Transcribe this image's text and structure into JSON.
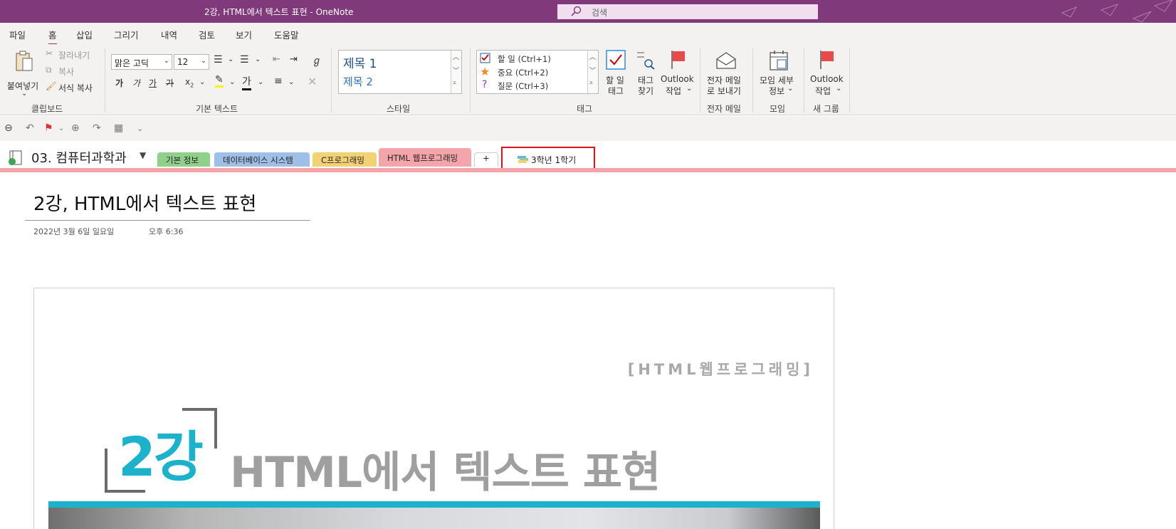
{
  "window": {
    "title": "2강, HTML에서 텍스트 표현  -  OneNote",
    "search_placeholder": "검색"
  },
  "menu": [
    "파일",
    "홈",
    "삽입",
    "그리기",
    "내역",
    "검토",
    "보기",
    "도움말"
  ],
  "ribbon": {
    "clipboard": {
      "paste": "붙여넣기",
      "cut": "잘라내기",
      "copy": "복사",
      "format_painter": "서식 복사",
      "label": "클립보드"
    },
    "basic_text": {
      "font": "맑은 고딕",
      "size": "12",
      "bold": "가",
      "italic": "가",
      "underline": "가",
      "strike": "가",
      "subscript": "x",
      "label": "기본 텍스트"
    },
    "styles": {
      "items": [
        "제목 1",
        "제목 2"
      ],
      "label": "스타일"
    },
    "tags": {
      "items": [
        "할 일 (Ctrl+1)",
        "중요 (Ctrl+2)",
        "질문 (Ctrl+3)"
      ],
      "todo_tag_line1": "할 일",
      "todo_tag_line2": "태그",
      "find_tags_line1": "태그",
      "find_tags_line2": "찾기",
      "outlook_line1": "Outlook",
      "outlook_line2": "작업",
      "label": "태그"
    },
    "email": {
      "send_line1": "전자 메일",
      "send_line2": "로 보내기",
      "label": "전자 메일"
    },
    "meetings": {
      "details_line1": "모임 세부",
      "details_line2": "정보",
      "label": "모임"
    },
    "new_group": {
      "outlook_line1": "Outlook",
      "outlook_line2": "작업",
      "label": "새 그룹"
    }
  },
  "notebook": {
    "name": "03. 컴퓨터과학과",
    "sections": [
      {
        "label": "기본 정보",
        "color": "#8fd18b"
      },
      {
        "label": "데이터베이스 시스템",
        "color": "#9dbfe8"
      },
      {
        "label": "C프로그래밍",
        "color": "#f2d275"
      },
      {
        "label": "HTML 웹프로그래밍",
        "color": "#f4a5a9"
      }
    ],
    "add_tab": "+",
    "section_group": "3학년 1학기"
  },
  "page": {
    "title": "2강, HTML에서 텍스트 표현",
    "date": "2022년 3월 6일 일요일",
    "time": "오후 6:36",
    "image": {
      "subject": "[HTML웹프로그래밍]",
      "lecture_number": "2강",
      "lecture_title": "HTML에서 텍스트 표현"
    }
  },
  "colors": {
    "titlebar": "#80397b",
    "ribbon": "#f3f2f1",
    "active_section": "#f4a5a9",
    "highlight_box": "#e0111b",
    "accent_cyan": "#1cb2cc"
  }
}
